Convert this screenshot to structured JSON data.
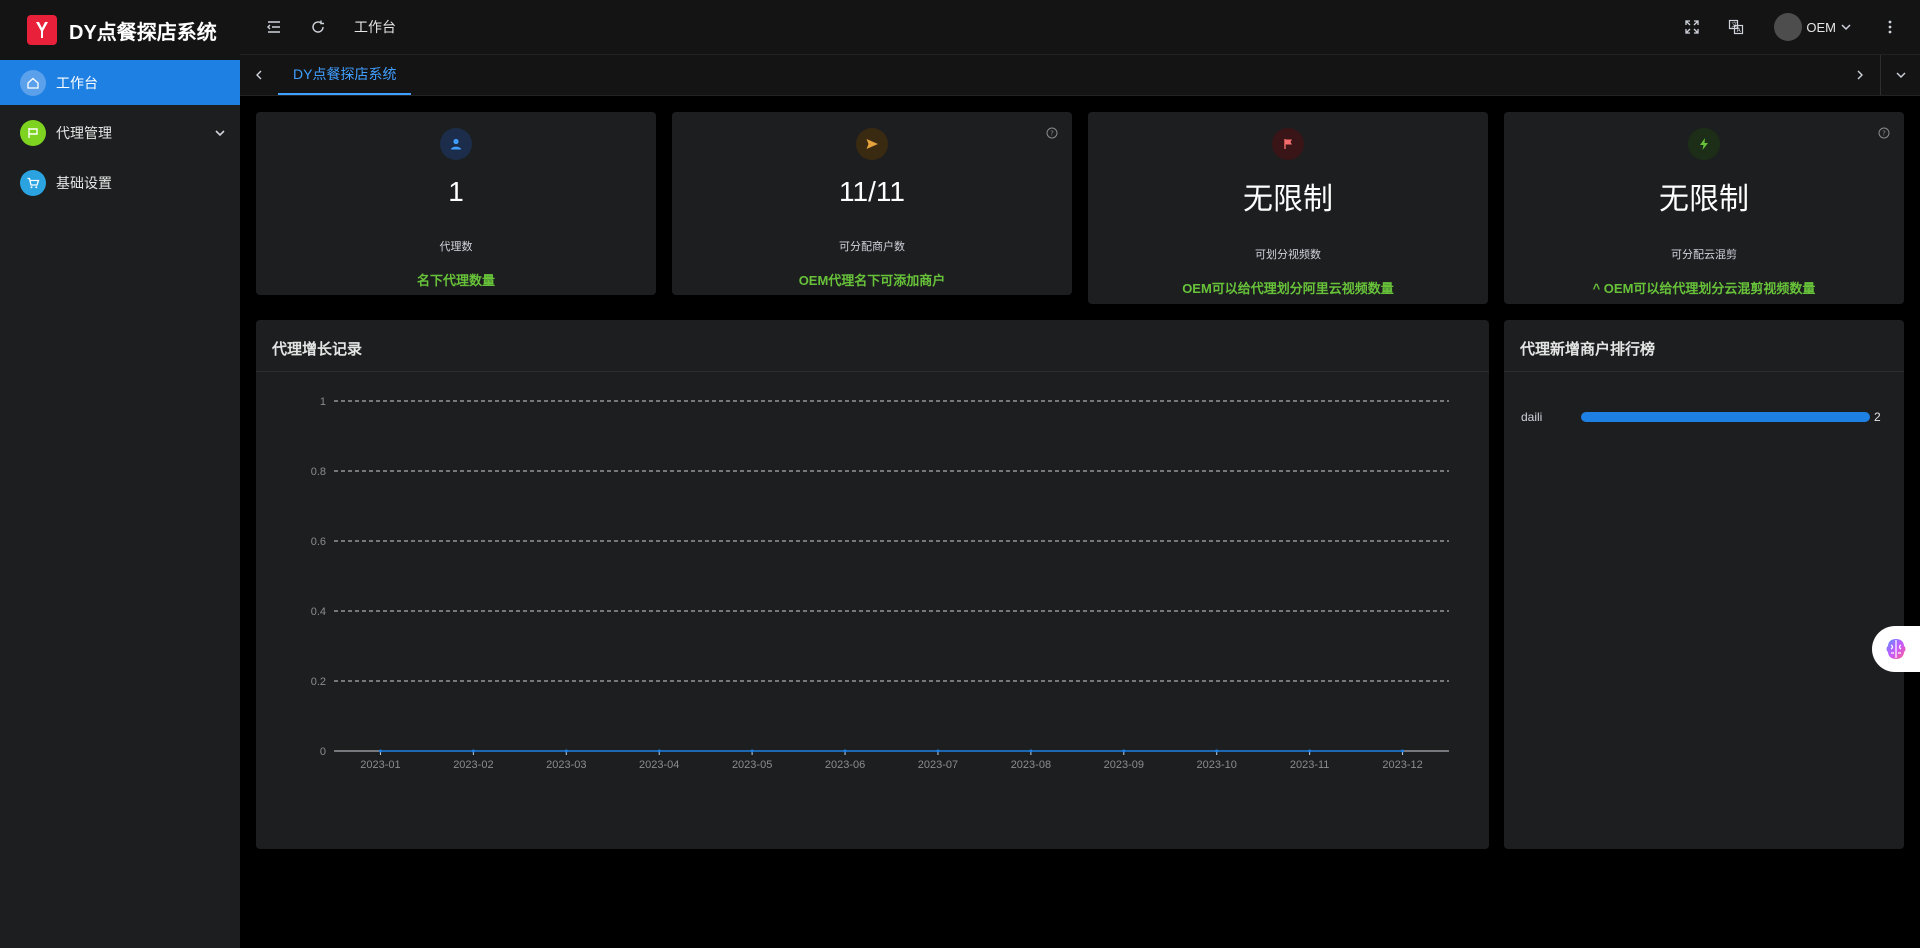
{
  "app": {
    "title": "DY点餐探店系统"
  },
  "sidebar": {
    "items": [
      {
        "label": "工作台",
        "icon": "home-icon",
        "color": "#3a7fd5",
        "active": true
      },
      {
        "label": "代理管理",
        "icon": "flag-icon",
        "color": "#7ed321",
        "active": false
      },
      {
        "label": "基础设置",
        "icon": "cart-icon",
        "color": "#2aa3e0",
        "active": false
      }
    ]
  },
  "header": {
    "breadcrumb": "工作台",
    "user": "OEM"
  },
  "tabs": [
    {
      "label": "DY点餐探店系统"
    }
  ],
  "stats": [
    {
      "value": "1",
      "label": "代理数",
      "desc": "名下代理数量",
      "icon": "user-icon",
      "icon_bg": "#1b2d4a",
      "icon_color": "#409eff",
      "help": false
    },
    {
      "value": "11/11",
      "label": "可分配商户数",
      "desc": "OEM代理名下可添加商户",
      "icon": "send-icon",
      "icon_bg": "#3a2a12",
      "icon_color": "#e6a23c",
      "help": true
    },
    {
      "value": "无限制",
      "label": "可划分视频数",
      "desc": "OEM可以给代理划分阿里云视频数量",
      "icon": "flag-icon",
      "icon_bg": "#3a1518",
      "icon_color": "#f56c6c",
      "help": false
    },
    {
      "value": "无限制",
      "label": "可分配云混剪",
      "desc": "^ OEM可以给代理划分云混剪视频数量",
      "icon": "bolt-icon",
      "icon_bg": "#1c2e17",
      "icon_color": "#67c23a",
      "help": true
    }
  ],
  "growth_panel": {
    "title": "代理增长记录"
  },
  "ranking_panel": {
    "title": "代理新增商户排行榜",
    "rows": [
      {
        "name": "daili",
        "value": 2,
        "max": 2
      }
    ]
  },
  "chart_data": {
    "type": "line",
    "title": "",
    "categories": [
      "2023-01",
      "2023-02",
      "2023-03",
      "2023-04",
      "2023-05",
      "2023-06",
      "2023-07",
      "2023-08",
      "2023-09",
      "2023-10",
      "2023-11",
      "2023-12"
    ],
    "ylim": [
      0,
      1
    ],
    "yticks": [
      "0",
      "0.2",
      "0.4",
      "0.6",
      "0.8",
      "1"
    ],
    "series": [
      {
        "values": [
          0,
          0,
          0,
          0,
          0,
          0,
          0,
          0,
          0,
          0,
          0,
          0
        ]
      }
    ],
    "grid": true
  }
}
